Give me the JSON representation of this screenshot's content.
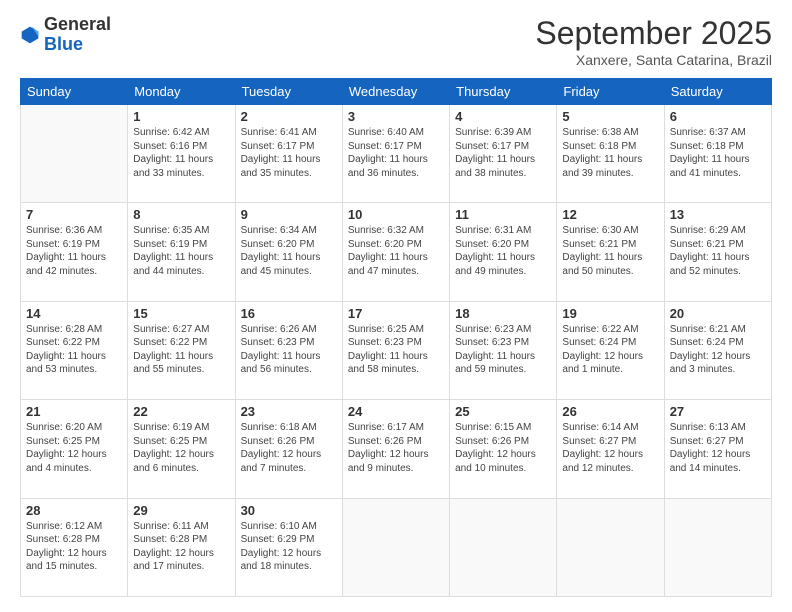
{
  "header": {
    "logo_general": "General",
    "logo_blue": "Blue",
    "month": "September 2025",
    "location": "Xanxere, Santa Catarina, Brazil"
  },
  "weekdays": [
    "Sunday",
    "Monday",
    "Tuesday",
    "Wednesday",
    "Thursday",
    "Friday",
    "Saturday"
  ],
  "weeks": [
    [
      {
        "day": "",
        "info": ""
      },
      {
        "day": "1",
        "info": "Sunrise: 6:42 AM\nSunset: 6:16 PM\nDaylight: 11 hours\nand 33 minutes."
      },
      {
        "day": "2",
        "info": "Sunrise: 6:41 AM\nSunset: 6:17 PM\nDaylight: 11 hours\nand 35 minutes."
      },
      {
        "day": "3",
        "info": "Sunrise: 6:40 AM\nSunset: 6:17 PM\nDaylight: 11 hours\nand 36 minutes."
      },
      {
        "day": "4",
        "info": "Sunrise: 6:39 AM\nSunset: 6:17 PM\nDaylight: 11 hours\nand 38 minutes."
      },
      {
        "day": "5",
        "info": "Sunrise: 6:38 AM\nSunset: 6:18 PM\nDaylight: 11 hours\nand 39 minutes."
      },
      {
        "day": "6",
        "info": "Sunrise: 6:37 AM\nSunset: 6:18 PM\nDaylight: 11 hours\nand 41 minutes."
      }
    ],
    [
      {
        "day": "7",
        "info": "Sunrise: 6:36 AM\nSunset: 6:19 PM\nDaylight: 11 hours\nand 42 minutes."
      },
      {
        "day": "8",
        "info": "Sunrise: 6:35 AM\nSunset: 6:19 PM\nDaylight: 11 hours\nand 44 minutes."
      },
      {
        "day": "9",
        "info": "Sunrise: 6:34 AM\nSunset: 6:20 PM\nDaylight: 11 hours\nand 45 minutes."
      },
      {
        "day": "10",
        "info": "Sunrise: 6:32 AM\nSunset: 6:20 PM\nDaylight: 11 hours\nand 47 minutes."
      },
      {
        "day": "11",
        "info": "Sunrise: 6:31 AM\nSunset: 6:20 PM\nDaylight: 11 hours\nand 49 minutes."
      },
      {
        "day": "12",
        "info": "Sunrise: 6:30 AM\nSunset: 6:21 PM\nDaylight: 11 hours\nand 50 minutes."
      },
      {
        "day": "13",
        "info": "Sunrise: 6:29 AM\nSunset: 6:21 PM\nDaylight: 11 hours\nand 52 minutes."
      }
    ],
    [
      {
        "day": "14",
        "info": "Sunrise: 6:28 AM\nSunset: 6:22 PM\nDaylight: 11 hours\nand 53 minutes."
      },
      {
        "day": "15",
        "info": "Sunrise: 6:27 AM\nSunset: 6:22 PM\nDaylight: 11 hours\nand 55 minutes."
      },
      {
        "day": "16",
        "info": "Sunrise: 6:26 AM\nSunset: 6:23 PM\nDaylight: 11 hours\nand 56 minutes."
      },
      {
        "day": "17",
        "info": "Sunrise: 6:25 AM\nSunset: 6:23 PM\nDaylight: 11 hours\nand 58 minutes."
      },
      {
        "day": "18",
        "info": "Sunrise: 6:23 AM\nSunset: 6:23 PM\nDaylight: 11 hours\nand 59 minutes."
      },
      {
        "day": "19",
        "info": "Sunrise: 6:22 AM\nSunset: 6:24 PM\nDaylight: 12 hours\nand 1 minute."
      },
      {
        "day": "20",
        "info": "Sunrise: 6:21 AM\nSunset: 6:24 PM\nDaylight: 12 hours\nand 3 minutes."
      }
    ],
    [
      {
        "day": "21",
        "info": "Sunrise: 6:20 AM\nSunset: 6:25 PM\nDaylight: 12 hours\nand 4 minutes."
      },
      {
        "day": "22",
        "info": "Sunrise: 6:19 AM\nSunset: 6:25 PM\nDaylight: 12 hours\nand 6 minutes."
      },
      {
        "day": "23",
        "info": "Sunrise: 6:18 AM\nSunset: 6:26 PM\nDaylight: 12 hours\nand 7 minutes."
      },
      {
        "day": "24",
        "info": "Sunrise: 6:17 AM\nSunset: 6:26 PM\nDaylight: 12 hours\nand 9 minutes."
      },
      {
        "day": "25",
        "info": "Sunrise: 6:15 AM\nSunset: 6:26 PM\nDaylight: 12 hours\nand 10 minutes."
      },
      {
        "day": "26",
        "info": "Sunrise: 6:14 AM\nSunset: 6:27 PM\nDaylight: 12 hours\nand 12 minutes."
      },
      {
        "day": "27",
        "info": "Sunrise: 6:13 AM\nSunset: 6:27 PM\nDaylight: 12 hours\nand 14 minutes."
      }
    ],
    [
      {
        "day": "28",
        "info": "Sunrise: 6:12 AM\nSunset: 6:28 PM\nDaylight: 12 hours\nand 15 minutes."
      },
      {
        "day": "29",
        "info": "Sunrise: 6:11 AM\nSunset: 6:28 PM\nDaylight: 12 hours\nand 17 minutes."
      },
      {
        "day": "30",
        "info": "Sunrise: 6:10 AM\nSunset: 6:29 PM\nDaylight: 12 hours\nand 18 minutes."
      },
      {
        "day": "",
        "info": ""
      },
      {
        "day": "",
        "info": ""
      },
      {
        "day": "",
        "info": ""
      },
      {
        "day": "",
        "info": ""
      }
    ]
  ]
}
